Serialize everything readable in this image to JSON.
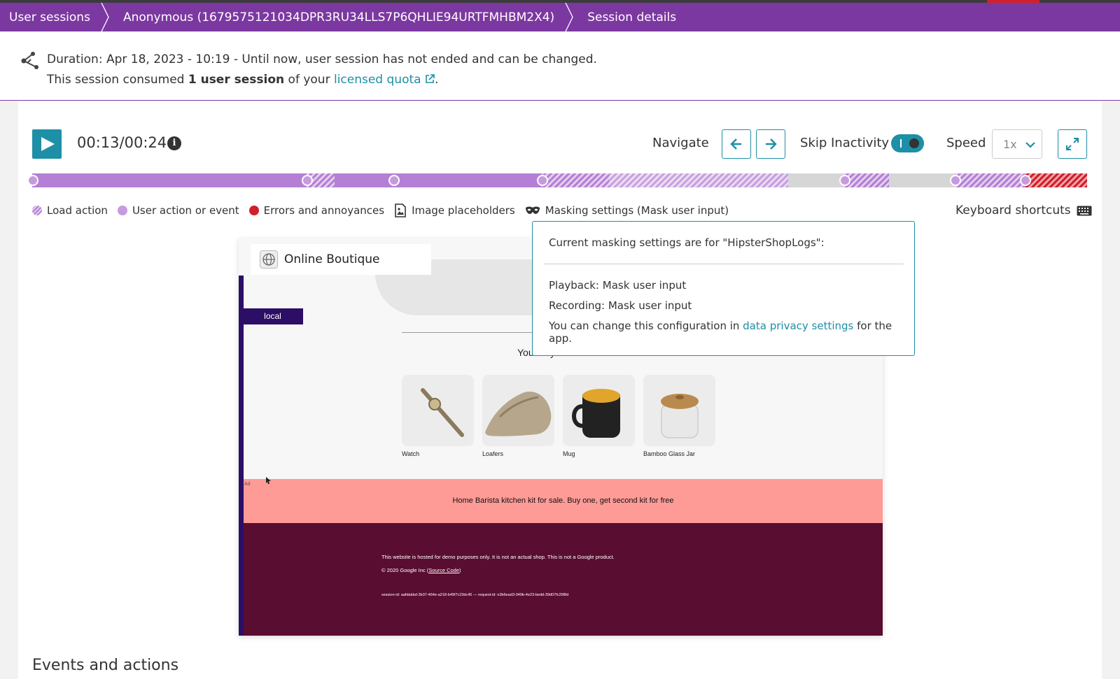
{
  "breadcrumb": {
    "items": [
      {
        "label": "User sessions"
      },
      {
        "label": "Anonymous (1679575121034DPR3RU34LLS7P6QHLIE94URTFMHBM2X4)"
      },
      {
        "label": "Session details"
      }
    ]
  },
  "session_info": {
    "duration_text": "Duration: Apr 18, 2023 - 10:19 - Until now, user session has not ended and can be changed.",
    "consumed_prefix": "This session consumed ",
    "consumed_bold": "1 user session",
    "consumed_mid": " of your ",
    "quota_link": "licensed quota",
    "consumed_suffix": "."
  },
  "player": {
    "time": "00:13/00:24",
    "progress_fraction": 0.54,
    "navigate_label": "Navigate",
    "skip_inactivity_label": "Skip Inactivity",
    "skip_inactivity_on": true,
    "speed_label": "Speed",
    "speed_value": "1x",
    "icons": [
      "play-icon",
      "info-icon",
      "arrow-left-icon",
      "arrow-right-icon",
      "chevron-down-icon",
      "fullscreen-icon"
    ]
  },
  "legend": {
    "load_action": "Load action",
    "user_action": "User action or event",
    "errors": "Errors and annoyances",
    "image_placeholders": "Image placeholders",
    "masking": "Masking settings (Mask user input)",
    "keyboard_shortcuts": "Keyboard shortcuts"
  },
  "colors": {
    "brand_purple": "#7c38a1",
    "accent_teal": "#1d8fa6",
    "user_action": "#b57fd6",
    "error_red": "#d1202b"
  },
  "replay": {
    "tab_title": "Online Boutique",
    "local_badge": "local",
    "section_title": "You May Also Like",
    "products": [
      {
        "name": "Watch"
      },
      {
        "name": "Loafers"
      },
      {
        "name": "Mug"
      },
      {
        "name": "Bamboo Glass Jar"
      }
    ],
    "ad_label": "Ad",
    "ad_text": "Home Barista kitchen kit for sale. Buy one, get second kit for free",
    "footer_line1": "This website is hosted for demo purposes only. It is not an actual shop. This is not a Google product.",
    "footer_line2_prefix": "© 2020 Google Inc (",
    "footer_line2_link": "Source Code",
    "footer_line2_suffix": ")",
    "footer_line3": "session-id: aafdabbd-3b37-464e-a218-b49f7c23dc45 — request-id: e3b6ead3-049b-4e23-bedd-39d07fc29f8d"
  },
  "masking_tooltip": {
    "heading": "Current masking settings are for \"HipsterShopLogs\":",
    "playback": "Playback: Mask user input",
    "recording": "Recording: Mask user input",
    "config_prefix": "You can change this configuration in ",
    "config_link": "data privacy settings",
    "config_suffix": " for the app."
  },
  "events_title": "Events and actions"
}
